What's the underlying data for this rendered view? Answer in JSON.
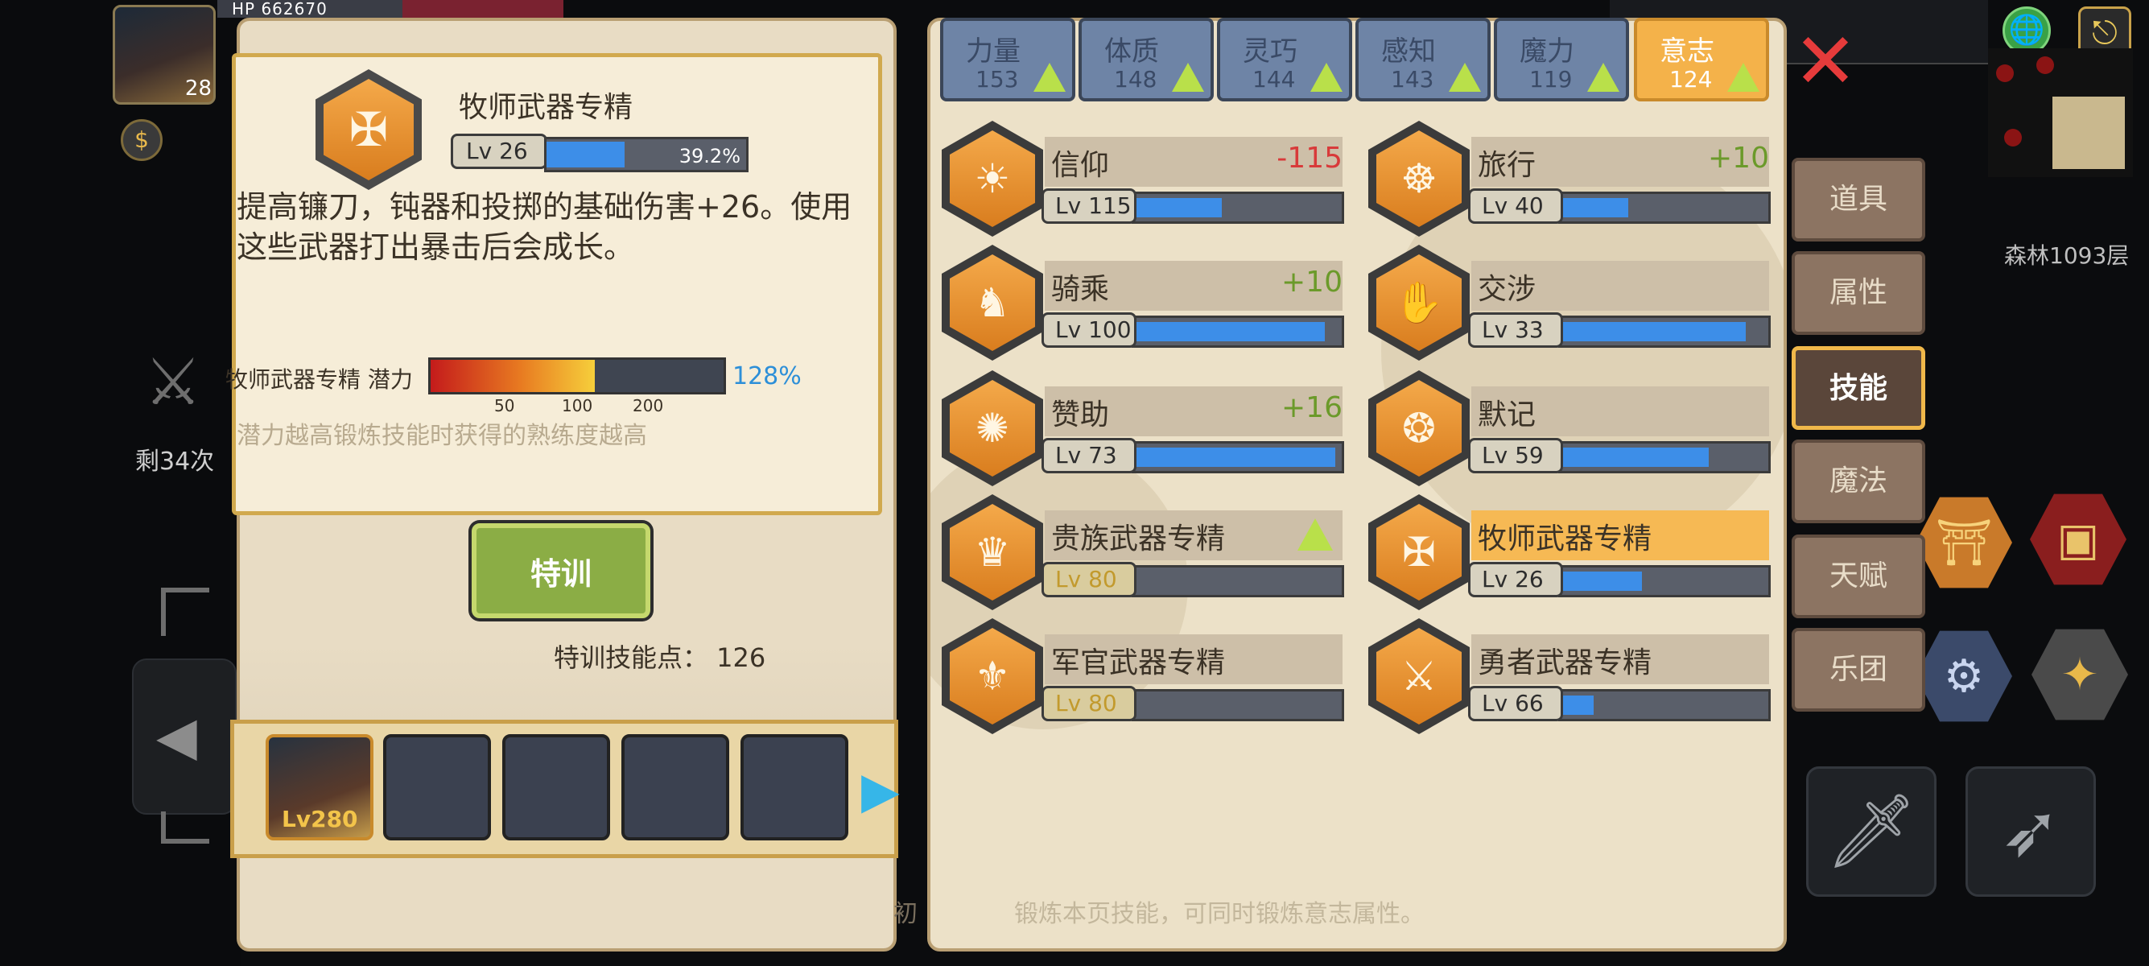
{
  "hud": {
    "hp_text": "HP 662670",
    "player_level": "28",
    "remaining_text": "剩34次",
    "area_text": "森林1093层"
  },
  "info": {
    "skill_name": "牧师武器专精",
    "level": "Lv 26",
    "progress": 0.392,
    "progress_text": "39.2%",
    "description": "提高镰刀，钝器和投掷的基础伤害+26。使用这些武器打出暴击后会成长。",
    "potential_label": "牧师武器专精 潜力",
    "potential_ticks": [
      "50",
      "100",
      "200"
    ],
    "potential_pct": "128%",
    "potential_fill": 0.56,
    "potential_hint": "潜力越高锻炼技能时获得的熟练度越高",
    "train_button": "特训",
    "train_points": "特训技能点：  126",
    "party_level": "Lv280"
  },
  "attributes": [
    {
      "name": "力量",
      "value": "153",
      "active": false
    },
    {
      "name": "体质",
      "value": "148",
      "active": false
    },
    {
      "name": "灵巧",
      "value": "144",
      "active": false
    },
    {
      "name": "感知",
      "value": "143",
      "active": false
    },
    {
      "name": "魔力",
      "value": "119",
      "active": false
    },
    {
      "name": "意志",
      "value": "124",
      "active": true
    }
  ],
  "skills": [
    {
      "name": "信仰",
      "level": "Lv 115",
      "bonus": "-115",
      "bonus_color": "#d83a3a",
      "progress": 0.42,
      "icon": "☀",
      "icon_name": "sun-rays-icon"
    },
    {
      "name": "旅行",
      "level": "Lv 40",
      "bonus": "+10",
      "bonus_color": "#6b9a2a",
      "progress": 0.32,
      "icon": "☸",
      "icon_name": "wheel-icon"
    },
    {
      "name": "骑乘",
      "level": "Lv 100",
      "bonus": "+10",
      "bonus_color": "#6b9a2a",
      "progress": 0.93,
      "icon": "♞",
      "icon_name": "horse-icon"
    },
    {
      "name": "交涉",
      "level": "Lv 33",
      "bonus": "",
      "bonus_color": "#6b9a2a",
      "progress": 0.9,
      "icon": "✋",
      "icon_name": "handshake-icon"
    },
    {
      "name": "赞助",
      "level": "Lv 73",
      "bonus": "+16",
      "bonus_color": "#6b9a2a",
      "progress": 0.98,
      "icon": "✺",
      "icon_name": "coins-icon"
    },
    {
      "name": "默记",
      "level": "Lv 59",
      "bonus": "",
      "bonus_color": "#6b9a2a",
      "progress": 0.72,
      "icon": "❂",
      "icon_name": "brain-icon"
    },
    {
      "name": "贵族武器专精",
      "level": "Lv 80",
      "bonus": "",
      "bonus_color": "#6b9a2a",
      "progress": 0,
      "icon": "♛",
      "icon_name": "crown-icon",
      "gold": true,
      "up": true
    },
    {
      "name": "牧师武器专精",
      "level": "Lv 26",
      "bonus": "",
      "bonus_color": "#6b9a2a",
      "progress": 0.39,
      "icon": "✠",
      "icon_name": "priest-emblem-icon",
      "highlight": true
    },
    {
      "name": "军官武器专精",
      "level": "Lv 80",
      "bonus": "",
      "bonus_color": "#6b9a2a",
      "progress": 0,
      "icon": "⚜",
      "icon_name": "fleur-de-lis-icon",
      "gold": true
    },
    {
      "name": "勇者武器专精",
      "level": "Lv 66",
      "bonus": "",
      "bonus_color": "#6b9a2a",
      "progress": 0.15,
      "icon": "⚔",
      "icon_name": "sword-shield-icon"
    }
  ],
  "side_menu": [
    {
      "label": "道具",
      "active": false
    },
    {
      "label": "属性",
      "active": false
    },
    {
      "label": "技能",
      "active": true
    },
    {
      "label": "魔法",
      "active": false
    },
    {
      "label": "天赋",
      "active": false
    },
    {
      "label": "乐团",
      "active": false
    }
  ],
  "footer_hint": "锻炼本页技能，可同时锻炼意志属性。",
  "footer_hint_left": "初",
  "icons": {
    "close": "✕",
    "exit": "⎋",
    "globe": "🌐",
    "next": "▶",
    "left_arrow": "◀"
  }
}
